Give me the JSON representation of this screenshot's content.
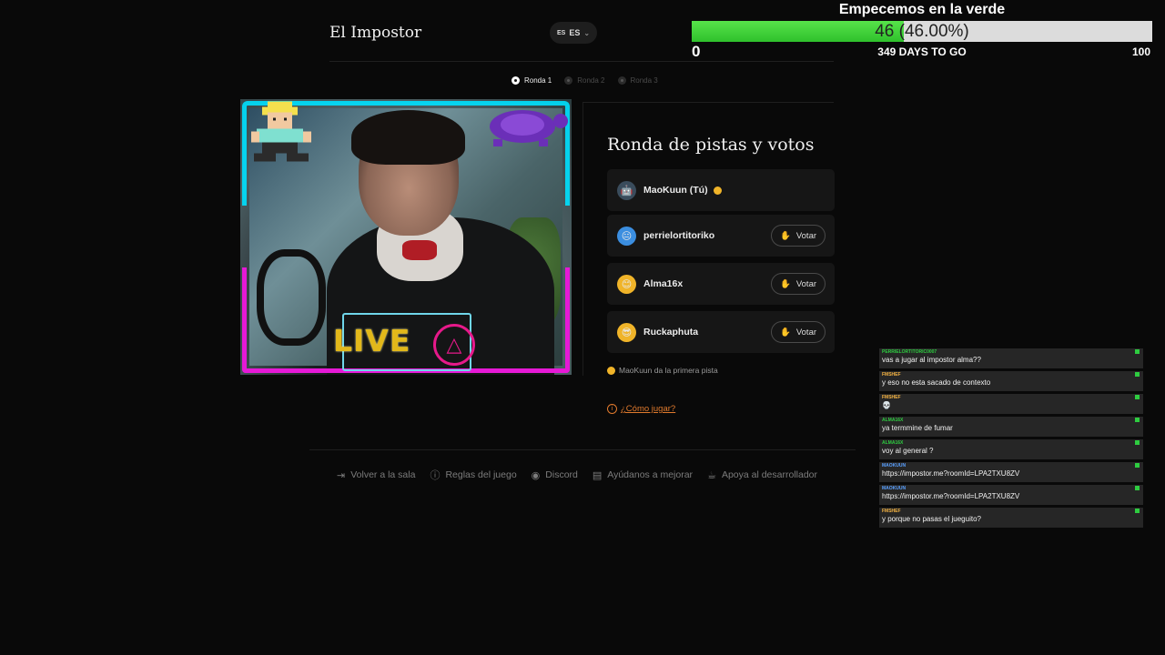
{
  "header": {
    "app_title": "El Impostor",
    "lang_flag": "ES",
    "lang_code": "ES"
  },
  "goal": {
    "title": "Empecemos en la verde",
    "display": "46 (46.00%)",
    "current": 46,
    "progress_fraction": 0.46,
    "min": "0",
    "max": "100",
    "days_left": "349 DAYS TO GO"
  },
  "steps": [
    {
      "label": "Ronda 1",
      "active": true
    },
    {
      "label": "Ronda 2",
      "active": false
    },
    {
      "label": "Ronda 3",
      "active": false
    }
  ],
  "webcam": {
    "overlay_text": "LIVE"
  },
  "panel": {
    "title": "Ronda de pistas y votos",
    "players": [
      {
        "name": "MaoKuun (Tú)",
        "avatar_icon": "robot-icon",
        "avatar_color": "#3a4c5c",
        "first_clue": true,
        "can_vote": false
      },
      {
        "name": "perrielortitoriko",
        "avatar_icon": "face-icon",
        "avatar_color": "#3b8ee0",
        "first_clue": false,
        "can_vote": true
      },
      {
        "name": "Alma16x",
        "avatar_icon": "smile-icon",
        "avatar_color": "#f0b429",
        "first_clue": false,
        "can_vote": true
      },
      {
        "name": "Ruckaphuta",
        "avatar_icon": "sunglasses-icon",
        "avatar_color": "#f0b429",
        "first_clue": false,
        "can_vote": true
      }
    ],
    "vote_label": "Votar",
    "first_clue_note": "MaoKuun da la primera pista",
    "how_to_play": "¿Cómo jugar?"
  },
  "footer": {
    "links": [
      {
        "label": "Volver a la sala",
        "icon": "exit-icon"
      },
      {
        "label": "Reglas del juego",
        "icon": "info-icon"
      },
      {
        "label": "Discord",
        "icon": "discord-icon"
      },
      {
        "label": "Ayúdanos a mejorar",
        "icon": "feedback-icon"
      },
      {
        "label": "Apoya al desarrollador",
        "icon": "coffee-icon"
      }
    ]
  },
  "chat": {
    "messages": [
      {
        "user": "PERRIELORTITORIC0007",
        "user_color": "#2ecc40",
        "text": "vas a jugar al impostor alma??"
      },
      {
        "user": "FMSHEF",
        "user_color": "#f5b342",
        "text": "y eso no esta sacado de contexto"
      },
      {
        "user": "FMSHEF",
        "user_color": "#f5b342",
        "text": "💀"
      },
      {
        "user": "ALMA16X",
        "user_color": "#2ecc40",
        "text": "ya termmine de fumar"
      },
      {
        "user": "ALMA16X",
        "user_color": "#2ecc40",
        "text": "voy al general ?"
      },
      {
        "user": "MAOKUUN",
        "user_color": "#5aa0ff",
        "text": "https://impostor.me?roomId=LPA2TXU8ZV"
      },
      {
        "user": "MAOKUUN",
        "user_color": "#5aa0ff",
        "text": "https://impostor.me?roomId=LPA2TXU8ZV"
      },
      {
        "user": "FMSHEF",
        "user_color": "#f5b342",
        "text": "y porque no pasas el jueguito?"
      }
    ]
  },
  "colors": {
    "accent_orange": "#e07a2d",
    "goal_green": "#3ed037",
    "frame_cyan": "#00e1ff",
    "frame_pink": "#e619d6"
  }
}
